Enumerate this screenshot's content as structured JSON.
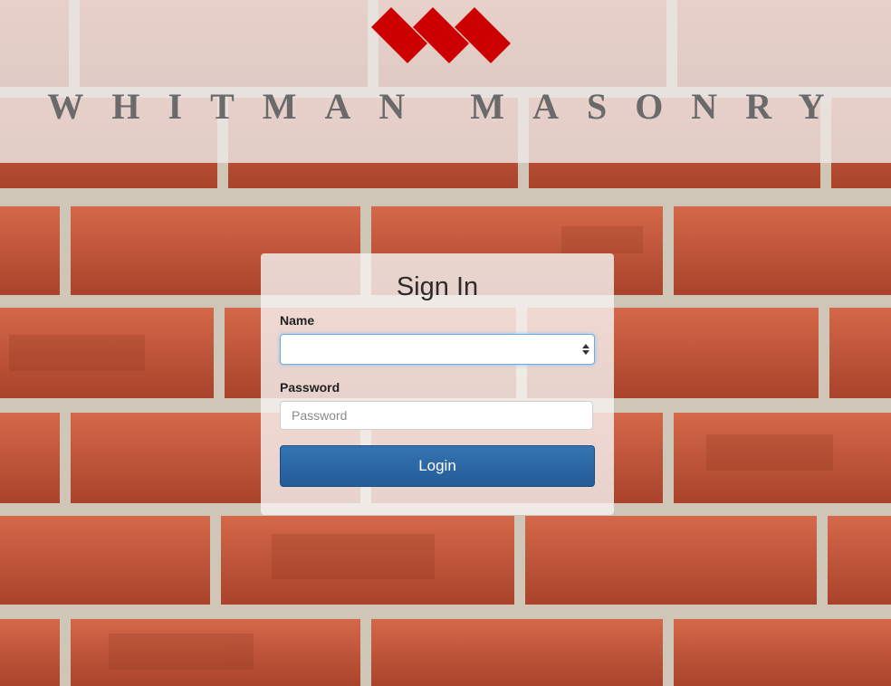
{
  "brand": {
    "name": "WHITMAN MASONRY",
    "logo_icon": "red-diamond-triple-logo",
    "logo_color": "#cc0000"
  },
  "signin": {
    "title": "Sign In",
    "name_label": "Name",
    "name_value": "",
    "password_label": "Password",
    "password_placeholder": "Password",
    "password_value": "",
    "login_label": "Login"
  },
  "colors": {
    "button": "#2a67a4",
    "brand_text": "#6a6a6a",
    "focus_border": "#66afe9"
  }
}
